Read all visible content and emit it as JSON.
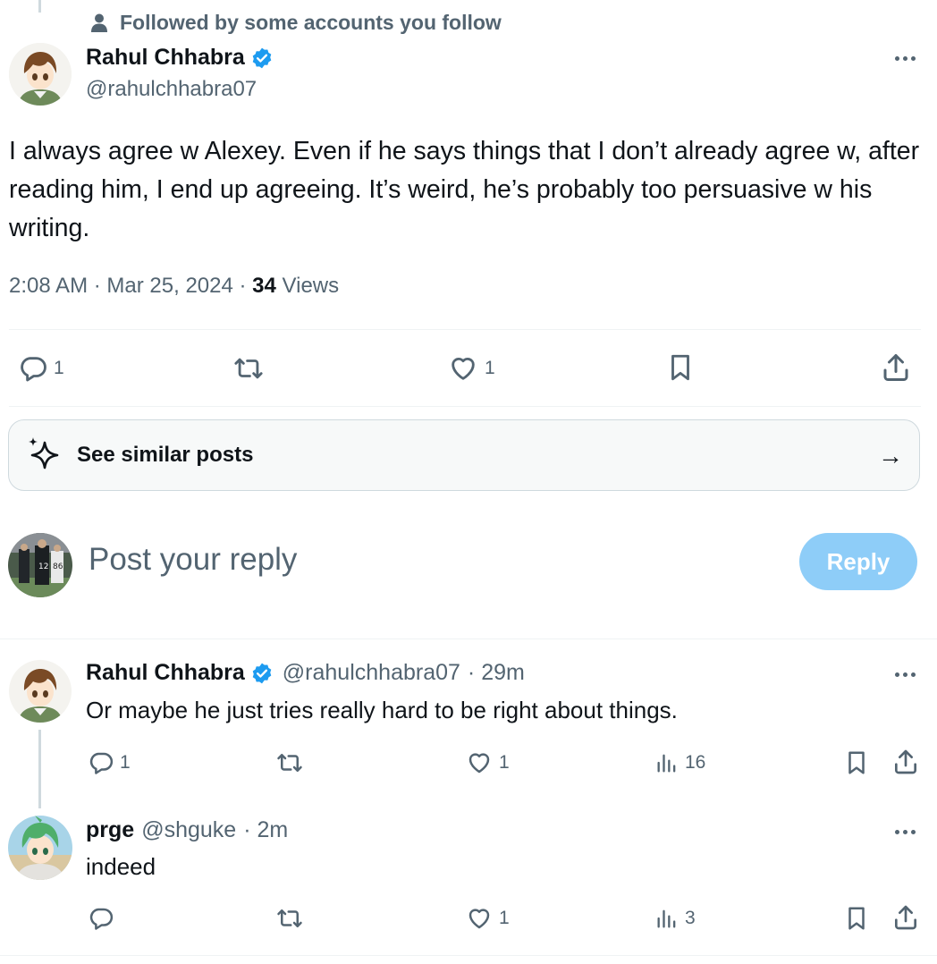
{
  "social_context": {
    "text": "Followed by some accounts you follow",
    "icon": "person-icon"
  },
  "main_post": {
    "display_name": "Rahul Chhabra",
    "handle": "@rahulchhabra07",
    "text": "I always agree w Alexey. Even if he says things that I don’t already agree w, after reading him, I end up agreeing. It’s weird, he’s probably too persuasive w his writing.",
    "time": "2:08 AM",
    "date": "Mar 25, 2024",
    "views_count": "34",
    "views_label": "Views",
    "replies": "1",
    "likes": "1",
    "sep": "·"
  },
  "similar": {
    "label": "See similar posts",
    "arrow": "→"
  },
  "composer": {
    "placeholder": "Post your reply",
    "button": "Reply"
  },
  "replies": [
    {
      "display_name": "Rahul Chhabra",
      "handle": "@rahulchhabra07",
      "time": "· 29m",
      "text": "Or maybe he just tries really hard to be right about things.",
      "replies": "1",
      "likes": "1",
      "views": "16"
    },
    {
      "display_name": "prge",
      "handle": "@shguke",
      "time": "· 2m",
      "text": "indeed",
      "replies": "",
      "likes": "1",
      "views": "3"
    }
  ],
  "colors": {
    "accent": "#1d9bf0",
    "reply_button": "#8ecdf8",
    "muted": "#536471",
    "border": "#cfd9de"
  }
}
